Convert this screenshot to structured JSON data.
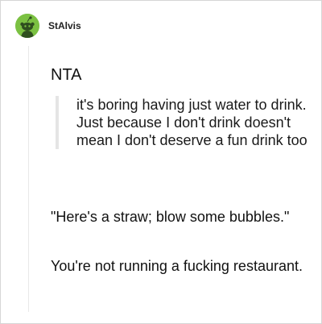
{
  "post": {
    "username": "StAlvis",
    "avatar_icon": "reddit-alien-icon",
    "avatar_color": "#7bc142",
    "verdict": "NTA",
    "quote": "it's boring having just water to drink. Just because I don't drink doesn't mean I don't deserve a fun drink too",
    "paragraphs": [
      "\"Here's a straw; blow some bubbles.\"",
      "You're not running a fucking restaurant."
    ]
  }
}
